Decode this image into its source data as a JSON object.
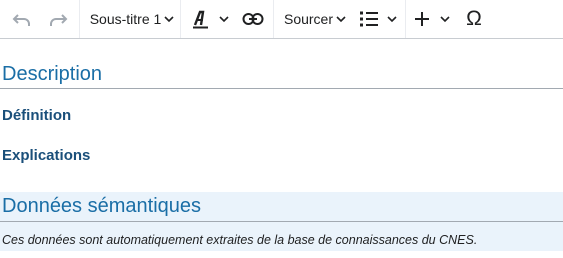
{
  "toolbar": {
    "undo_icon": "undo-icon",
    "redo_icon": "redo-icon",
    "heading_format_label": "Sous-titre 1",
    "text_style_icon": "text-style-icon",
    "link_icon": "link-icon",
    "cite_label": "Sourcer",
    "list_icon": "bullet-list-icon",
    "insert_icon": "plus-icon",
    "special_char_label": "Ω"
  },
  "content": {
    "section_description": "Description",
    "subsection_definition": "Définition",
    "subsection_explications": "Explications",
    "section_semantic": "Données sémantiques",
    "semantic_note": "Ces données sont automatiquement extraites de la base de connaissances du CNES."
  },
  "colors": {
    "heading": "#1a6ea6",
    "subheading": "#1a4f7a",
    "semantic_band": "#eaf3fb",
    "icon_disabled": "#a2a9b1",
    "icon": "#202122"
  }
}
